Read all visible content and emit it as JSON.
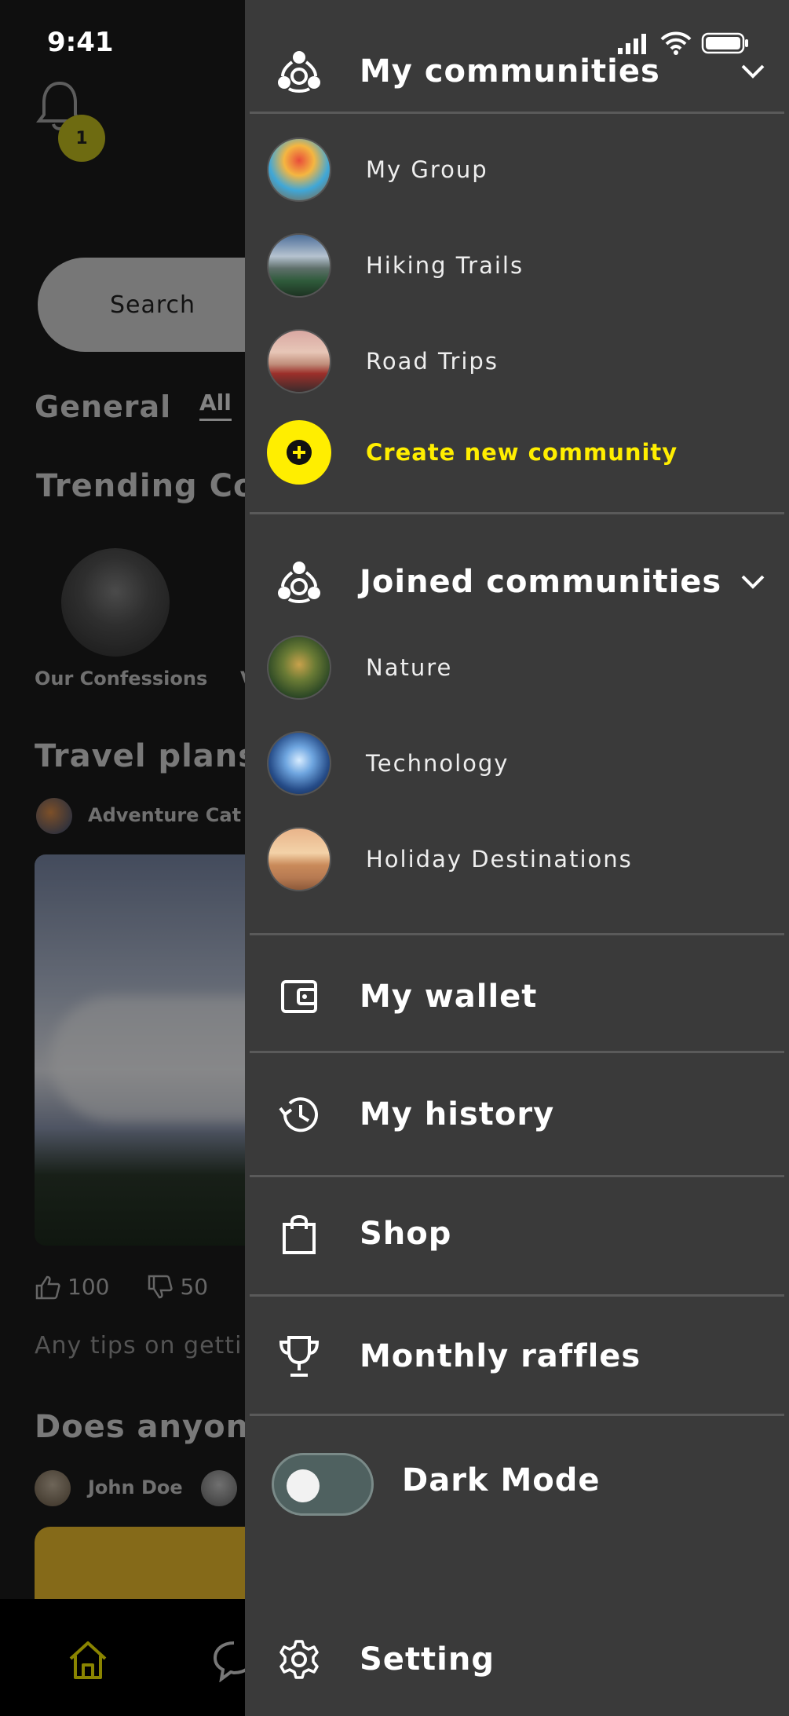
{
  "status": {
    "time": "9:41"
  },
  "background": {
    "notification_count": "1",
    "search_label": "Search",
    "general_label": "General",
    "all_tab": "All",
    "trending_label": "Trending Cor",
    "trending_first": "Our Confessions",
    "trending_next": "V",
    "travel_label": "Travel plans",
    "travel_author": "Adventure Cat",
    "likes": "100",
    "dislikes": "50",
    "tips_text": "Any tips on getti",
    "does_label": "Does anyone",
    "second_author": "John Doe"
  },
  "drawer": {
    "my_communities": {
      "title": "My communities",
      "items": [
        {
          "label": "My Group"
        },
        {
          "label": "Hiking Trails"
        },
        {
          "label": "Road Trips"
        }
      ],
      "create_label": "Create new community"
    },
    "joined_communities": {
      "title": "Joined communities",
      "items": [
        {
          "label": "Nature"
        },
        {
          "label": "Technology"
        },
        {
          "label": "Holiday Destinations"
        }
      ]
    },
    "menu": {
      "wallet": "My wallet",
      "history": "My history",
      "shop": "Shop",
      "raffles": "Monthly raffles",
      "dark_mode": "Dark Mode",
      "setting": "Setting"
    },
    "dark_mode_on": false
  },
  "colors": {
    "drawer_bg": "#3a3a3a",
    "accent_yellow": "#ffee00",
    "divider": "#5a5a5a"
  }
}
